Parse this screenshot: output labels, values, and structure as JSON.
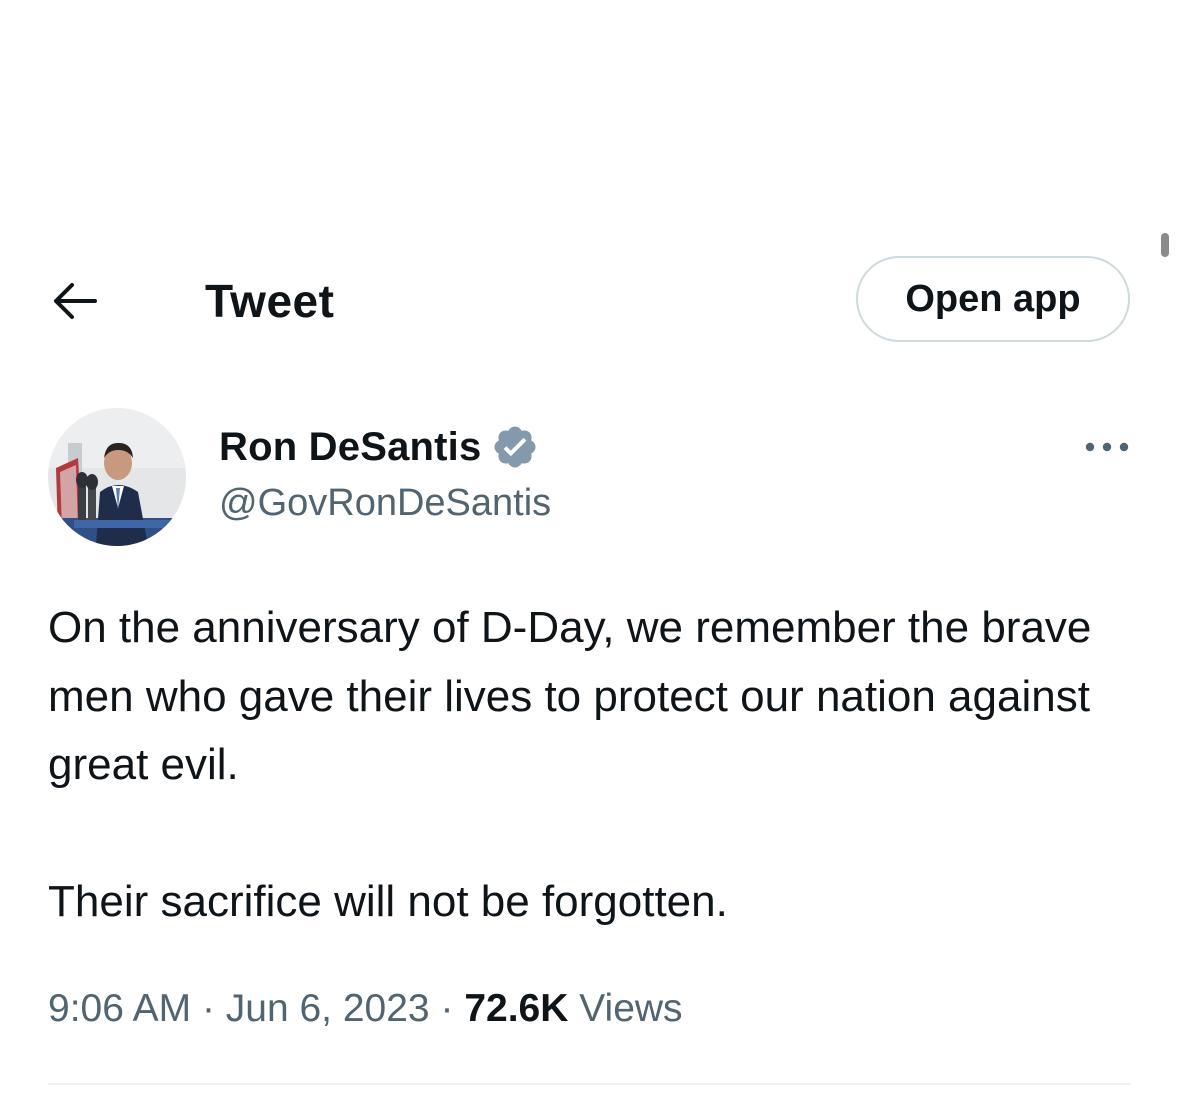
{
  "header": {
    "title": "Tweet",
    "back_icon": "arrow-left-icon",
    "open_app_label": "Open app"
  },
  "author": {
    "display_name": "Ron DeSantis",
    "handle": "@GovRonDeSantis",
    "verified_icon": "verified-badge-icon",
    "verified_color": "#829aab"
  },
  "tweet": {
    "paragraphs": [
      "On the anniversary of D-Day, we remember the brave men who gave their lives to protect our nation against great evil.",
      "Their sacrifice will not be forgotten."
    ],
    "time": "9:06 AM",
    "separator": "·",
    "date": "Jun 6, 2023",
    "views_count": "72.6K",
    "views_label": "Views"
  },
  "colors": {
    "text_primary": "#0f1419",
    "text_secondary": "#536471",
    "border": "#cfd9de",
    "divider": "#eff3f4"
  }
}
